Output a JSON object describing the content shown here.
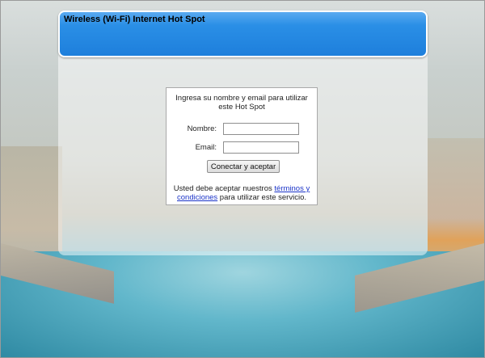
{
  "header": {
    "title": "Wireless (Wi-Fi) Internet Hot Spot"
  },
  "form": {
    "intro": "Ingresa su nombre y email para utilizar este Hot Spot",
    "name_label": "Nombre:",
    "name_value": "",
    "email_label": "Email:",
    "email_value": "",
    "submit_label": "Conectar y aceptar"
  },
  "terms": {
    "prefix": "Usted debe aceptar nuestros ",
    "link_text": "términos y condiciones",
    "suffix": " para utilizar este servicio."
  },
  "colors": {
    "header_blue": "#2a8fe6",
    "link": "#1a33c8"
  }
}
